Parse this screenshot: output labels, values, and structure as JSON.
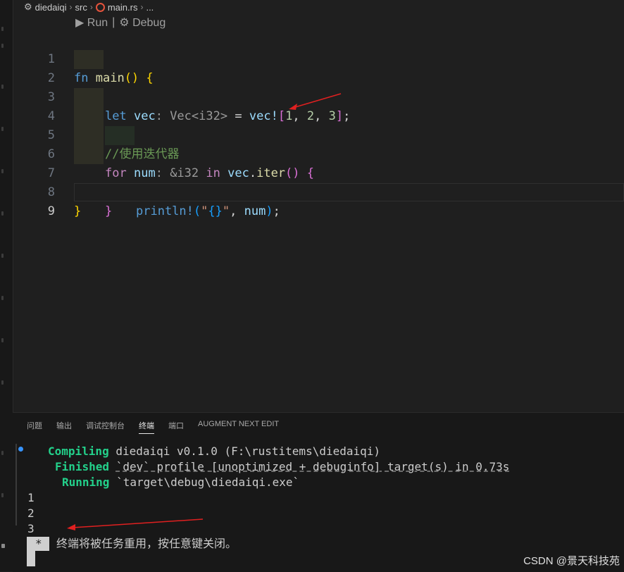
{
  "breadcrumb": {
    "project": "diedaiqi",
    "folder": "src",
    "file": "main.rs",
    "more": "..."
  },
  "codelens": {
    "run": "Run",
    "sep": "|",
    "debug": "Debug"
  },
  "editor": {
    "line_numbers": [
      "1",
      "2",
      "3",
      "4",
      "5",
      "6",
      "7",
      "8",
      "9"
    ],
    "active_line": "9"
  },
  "code": {
    "l1": {
      "kw": "fn",
      "name": "main",
      "open": "()",
      "brace": "{"
    },
    "l2": {
      "kw": "let",
      "var": "vec",
      "colon": ":",
      "type": "Vec",
      "lt": "<",
      "ty2": "i32",
      "gt": ">",
      "eq": "=",
      "mac": "vec!",
      "lb": "[",
      "n1": "1",
      "c1": ",",
      "n2": "2",
      "c2": ",",
      "n3": "3",
      "rb": "]",
      "semi": ";"
    },
    "l4": {
      "comment": "//使用迭代器"
    },
    "l5": {
      "kw": "for",
      "var": "num",
      "colon": ":",
      "hint": "&i32",
      "in": "in",
      "var2": "vec",
      "dot": ".",
      "method": "iter",
      "parens": "()",
      "brace": "{"
    },
    "l6": {
      "mac": "println!",
      "lp": "(",
      "q1": "\"",
      "fmt": "{}",
      "q2": "\"",
      "comma": ",",
      "var": "num",
      "rp": ")",
      "semi": ";"
    },
    "l7": {
      "brace": "}"
    },
    "l8": {
      "brace": "}"
    }
  },
  "panel": {
    "tabs": [
      "问题",
      "输出",
      "调试控制台",
      "终端",
      "端口",
      "AUGMENT NEXT EDIT"
    ],
    "active_tab": "终端"
  },
  "terminal": {
    "compiling_label": "Compiling",
    "compiling_text": "diedaiqi v0.1.0 (F:\\rustitems\\diedaiqi)",
    "finished_label": "Finished",
    "finished_text": "`dev` profile [unoptimized + debuginfo] target(s) in 0.73s",
    "running_label": "Running",
    "running_text": "`target\\debug\\diedaiqi.exe`",
    "outputs": [
      "1",
      "2",
      "3"
    ],
    "star": "*",
    "close_message": "终端将被任务重用，按任意键关闭。"
  },
  "watermark": "CSDN @景天科技苑",
  "colors": {
    "annotation_arrow": "#e02020",
    "terminal_green": "#23d18b",
    "accent_blue": "#3794ff"
  }
}
